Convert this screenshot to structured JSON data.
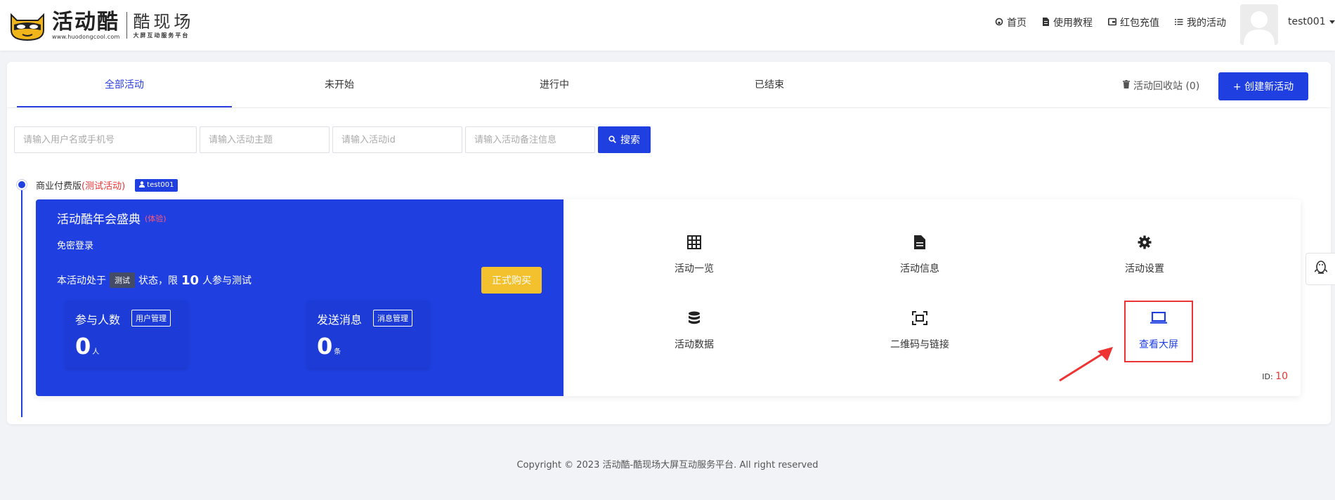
{
  "header": {
    "logo_cn": "活动酷",
    "logo_url": "www.huodongcool.com",
    "logo_sub": "酷现场",
    "logo_sub_small": "大屏互动服务平台",
    "nav": [
      {
        "label": "首页",
        "icon": "home-icon"
      },
      {
        "label": "使用教程",
        "icon": "document-icon"
      },
      {
        "label": "红包充值",
        "icon": "wallet-icon"
      },
      {
        "label": "我的活动",
        "icon": "list-icon"
      }
    ],
    "user_name": "test001"
  },
  "tabs": [
    "全部活动",
    "未开始",
    "进行中",
    "已结束"
  ],
  "active_tab": "全部活动",
  "recycle_label": "活动回收站 (0)",
  "create_button": "+ 创建新活动",
  "search": {
    "placeholders": [
      "请输入用户名或手机号",
      "请输入活动主题",
      "请输入活动id",
      "请输入活动备注信息"
    ],
    "button": "搜索"
  },
  "timeline": {
    "edition": "商业付费版",
    "edition_tag": "(测试活动)",
    "user_badge": "test001"
  },
  "activity": {
    "title": "活动酷年会盛典",
    "title_tag": "(体验)",
    "login_mode": "免密登录",
    "status_prefix": "本活动处于",
    "status_chip": "测试",
    "status_middle": "状态，限",
    "status_limit": "10",
    "status_suffix": "人参与测试",
    "buy_button": "正式购买",
    "stats": [
      {
        "label": "参与人数",
        "tag": "用户管理",
        "value": "0",
        "unit": "人"
      },
      {
        "label": "发送消息",
        "tag": "消息管理",
        "value": "0",
        "unit": "条"
      }
    ],
    "actions": [
      {
        "label": "活动一览",
        "icon": "grid-icon"
      },
      {
        "label": "活动信息",
        "icon": "file-icon"
      },
      {
        "label": "活动设置",
        "icon": "gear-icon"
      },
      {
        "label": "活动数据",
        "icon": "database-icon"
      },
      {
        "label": "二维码与链接",
        "icon": "scan-icon"
      },
      {
        "label": "查看大屏",
        "icon": "laptop-icon"
      }
    ],
    "id_label": "ID:",
    "id_value": "10"
  },
  "footer": "Copyright © 2023 活动酷-酷现场大屏互动服务平台. All right reserved",
  "colors": {
    "primary": "#1f3fe0",
    "buy": "#f3c12d",
    "highlight": "#ee3333"
  }
}
